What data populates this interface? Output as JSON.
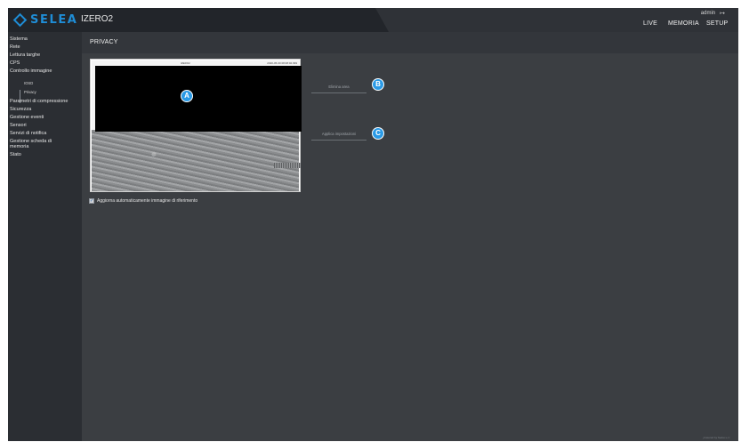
{
  "header": {
    "brand": "SELEA",
    "device_name": "IZERO2",
    "user": "admin",
    "logout_icon": "logout-icon",
    "nav": [
      "LIVE",
      "MEMORIA",
      "SETUP"
    ],
    "accent_color": "#1f8dd6"
  },
  "sidebar": {
    "items": [
      "Sistema",
      "Rete",
      "Lettura targhe",
      "CPS",
      "Controllo immagine",
      "IOSD",
      "Privacy",
      "Parametri di compressione",
      "Sicurezza",
      "Gestione eventi",
      "Sensori",
      "Servizi di notifica",
      "Gestione scheda di",
      "memoria",
      "Stato"
    ]
  },
  "content": {
    "title": "PRIVACY",
    "preview": {
      "osd_left": "IZERO2",
      "osd_right": "2020-05-30 08:08:02.099"
    },
    "buttons": {
      "delete_area": "Elimina area",
      "apply": "Applica impostazioni"
    },
    "callouts": [
      "A",
      "B",
      "C"
    ],
    "auto_update": {
      "checked": true,
      "label": "Aggiorna automaticamente immagine di riferimento"
    },
    "powered_by": "powered by Selea s.r.l."
  }
}
